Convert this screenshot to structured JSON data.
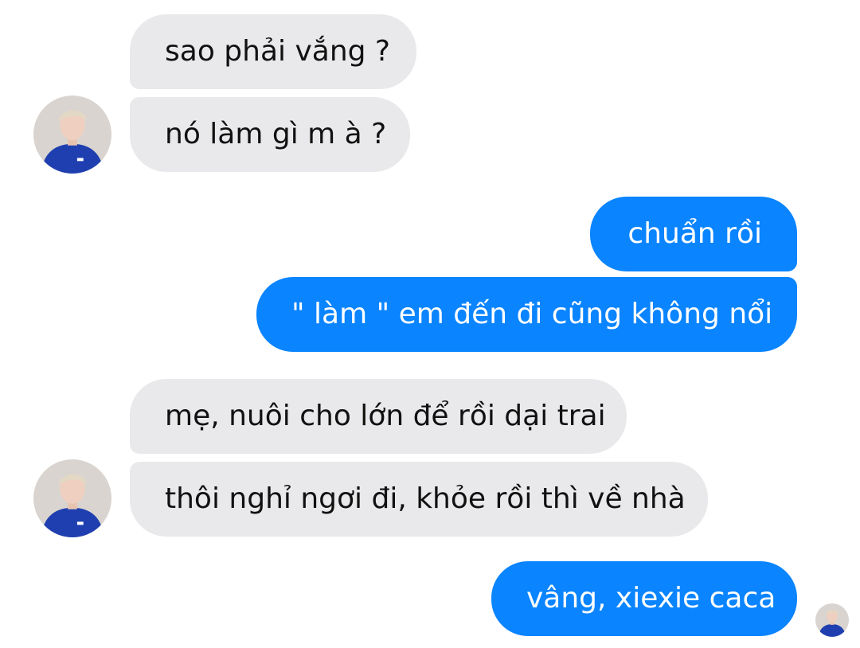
{
  "conversation": {
    "messages": [
      {
        "sender": "other",
        "text": "sao phải vắng ?"
      },
      {
        "sender": "other",
        "text": "nó làm gì m à ?"
      },
      {
        "sender": "me",
        "text": "chuẩn rồi"
      },
      {
        "sender": "me",
        "text": "\" làm \" em đến đi cũng không nổi"
      },
      {
        "sender": "other",
        "text": "mẹ, nuôi cho lớn để rồi dại trai"
      },
      {
        "sender": "other",
        "text": "thôi nghỉ ngơi đi, khỏe rồi thì về nhà"
      },
      {
        "sender": "me",
        "text": "vâng, xiexie caca"
      }
    ]
  },
  "colors": {
    "incoming_bubble": "#e9e9eb",
    "outgoing_bubble": "#0a84ff",
    "incoming_text": "#111111",
    "outgoing_text": "#ffffff",
    "avatar_shirt": "#1f3fb0"
  },
  "icons": {
    "avatar": "contact-avatar",
    "read_receipt": "seen-avatar-icon"
  }
}
